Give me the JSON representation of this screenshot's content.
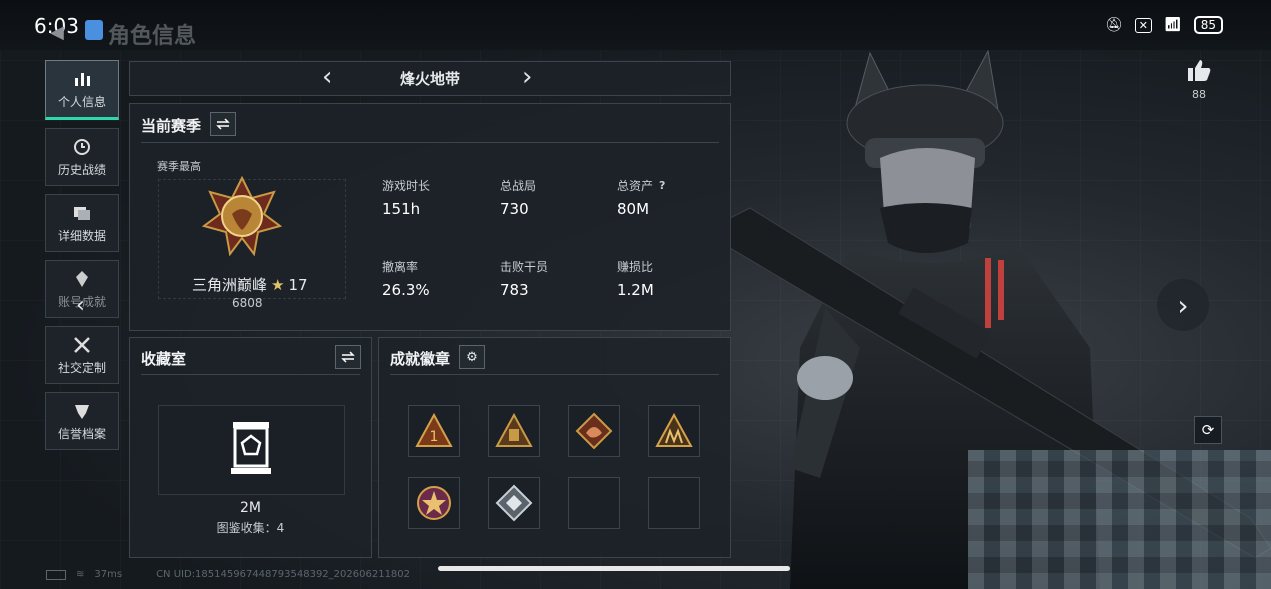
{
  "status_bar": {
    "time": "6:03",
    "screen_title": "角色信息",
    "battery": "85"
  },
  "sidebar": [
    {
      "label": "个人信息",
      "icon": "bar-chart-icon",
      "active": true
    },
    {
      "label": "历史战绩",
      "icon": "history-clock-icon"
    },
    {
      "label": "详细数据",
      "icon": "folder-icon"
    },
    {
      "label": "账号成就",
      "icon": "medal-icon"
    },
    {
      "label": "社交定制",
      "icon": "tools-icon"
    },
    {
      "label": "信誉档案",
      "icon": "shield-icon"
    }
  ],
  "mode_selector": {
    "title": "烽火地带"
  },
  "season": {
    "header": "当前赛季",
    "best_label": "赛季最高",
    "rank_name": "三角洲巅峰",
    "stars": "17",
    "score": "6808",
    "stats": [
      {
        "label": "游戏时长",
        "value": "151h"
      },
      {
        "label": "总战局",
        "value": "730"
      },
      {
        "label": "总资产",
        "value": "80M",
        "has_help": true
      },
      {
        "label": "撤离率",
        "value": "26.3%"
      },
      {
        "label": "击败干员",
        "value": "783"
      },
      {
        "label": "赚损比",
        "value": "1.2M"
      }
    ]
  },
  "collection": {
    "header": "收藏室",
    "value": "2M",
    "collect_label": "图鉴收集：4"
  },
  "badges": {
    "header": "成就徽章",
    "slots": [
      {
        "icon": "badge-triangle-1-icon"
      },
      {
        "icon": "badge-pyramid-icon"
      },
      {
        "icon": "badge-dragon-icon"
      },
      {
        "icon": "badge-squad-icon"
      },
      {
        "icon": "badge-star-medal-icon"
      },
      {
        "icon": "badge-diamond-icon"
      },
      {
        "icon": ""
      },
      {
        "icon": ""
      }
    ]
  },
  "likes": {
    "count": "88"
  },
  "footer": {
    "ping": "37ms",
    "uid": "CN UID:1851459674487935483​92_202606211802"
  },
  "colors": {
    "accent": "#2fd8a9",
    "gold": "#c99a45",
    "panel": "#1c2228"
  }
}
